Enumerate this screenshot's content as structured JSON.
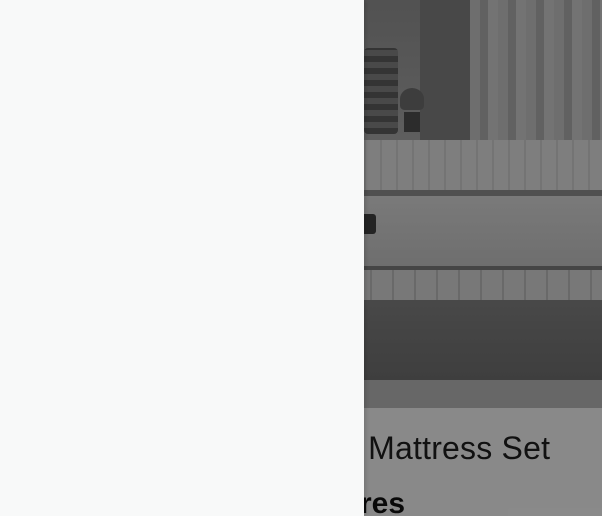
{
  "page": {
    "product_title": "Queen Mattress Set",
    "section_heading": "Features"
  },
  "drawer": {
    "open": true
  },
  "overlay": {
    "visible": true
  }
}
